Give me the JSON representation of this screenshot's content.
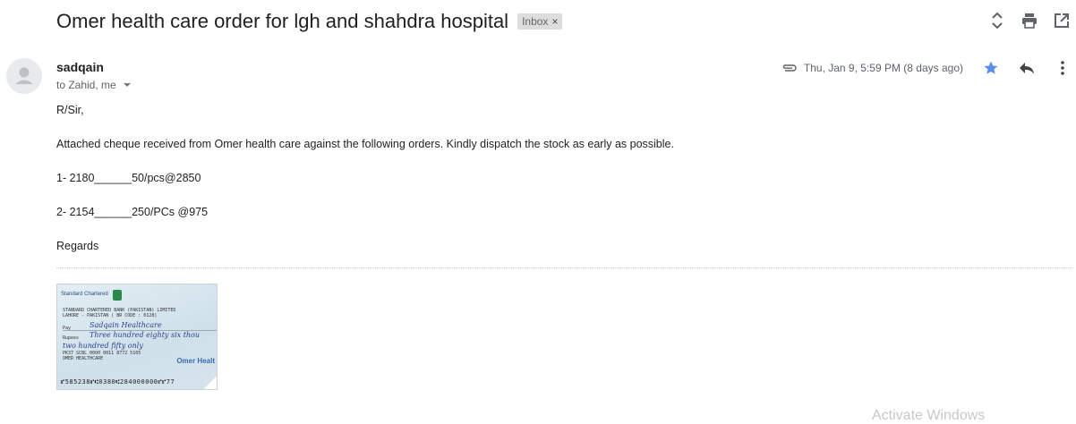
{
  "email": {
    "subject": "Omer health care order for lgh and shahdra hospital",
    "label": "Inbox",
    "label_remove": "×",
    "sender": "sadqain",
    "recipients": "to Zahid, me",
    "date": "Thu, Jan 9, 5:59 PM (8 days ago)",
    "starred": true,
    "star_color": "#5b8def",
    "body": [
      "R/Sir,",
      "Attached cheque received from Omer health care against the following  orders. Kindly dispatch the stock as early as possible.",
      "1- 2180______50/pcs@2850",
      "2- 2154______250/PCs @975",
      "Regards"
    ]
  },
  "toolbar": {
    "icons": [
      "expand-collapse-icon",
      "print-icon",
      "open-in-new-window-icon"
    ]
  },
  "actions": {
    "icons": [
      "attachment-icon",
      "star-icon",
      "reply-icon",
      "more-options-icon"
    ]
  },
  "attachment": {
    "bank_name": "Standard Chartered",
    "lines": [
      "STANDARD CHARTERED BANK (PAKISTAN) LIMITED",
      "LAHORE - PAKISTAN ( BR CODE : 0128)",
      "PK37 SCBL 0000 0011 8772 5105",
      "OMER HEALTHCARE"
    ],
    "pay_label": "Pay",
    "rupees_label": "Rupees",
    "payee_handwritten": "Sadqain Healthcare",
    "amount_handwritten_1": "Three hundred eighty six thou",
    "amount_handwritten_2": "two hundred fifty only",
    "payee_print": "Omer Healt",
    "micr": "⑈585238⑈⑆0380⑆284000000⑈⑈77"
  },
  "system": {
    "watermark": "Activate Windows"
  }
}
